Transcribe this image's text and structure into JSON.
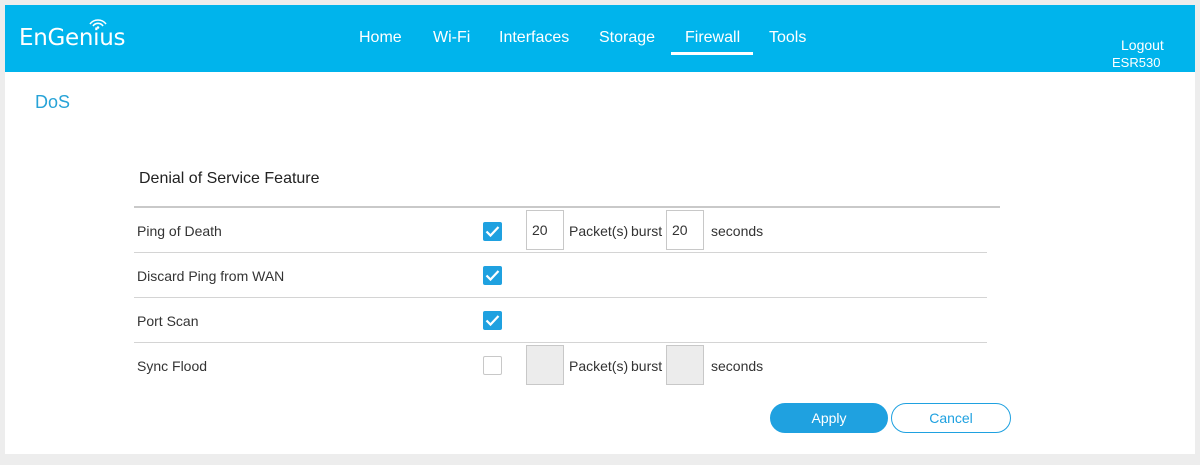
{
  "header": {
    "brand": "EnGenius",
    "nav": [
      {
        "label": "Home"
      },
      {
        "label": "Wi-Fi"
      },
      {
        "label": "Interfaces"
      },
      {
        "label": "Storage"
      },
      {
        "label": "Firewall",
        "active": true
      },
      {
        "label": "Tools"
      }
    ],
    "logout_label": "Logout",
    "model": "ESR530"
  },
  "page": {
    "title": "DoS",
    "section_title": "Denial of Service Feature"
  },
  "rows": [
    {
      "label": "Ping of Death",
      "checked": true,
      "packets": "20",
      "packets_label": "Packet(s)",
      "burst_label": "burst",
      "burst": "20",
      "seconds_label": "seconds"
    },
    {
      "label": "Discard Ping from WAN",
      "checked": true
    },
    {
      "label": "Port Scan",
      "checked": true
    },
    {
      "label": "Sync Flood",
      "checked": false,
      "packets": "",
      "packets_label": "Packet(s)",
      "burst_label": "burst",
      "burst": "",
      "seconds_label": "seconds"
    }
  ],
  "buttons": {
    "apply_label": "Apply",
    "cancel_label": "Cancel"
  },
  "colors": {
    "header_bg": "#00b4ec",
    "accent": "#1fa1e0",
    "title": "#27a3d7"
  }
}
